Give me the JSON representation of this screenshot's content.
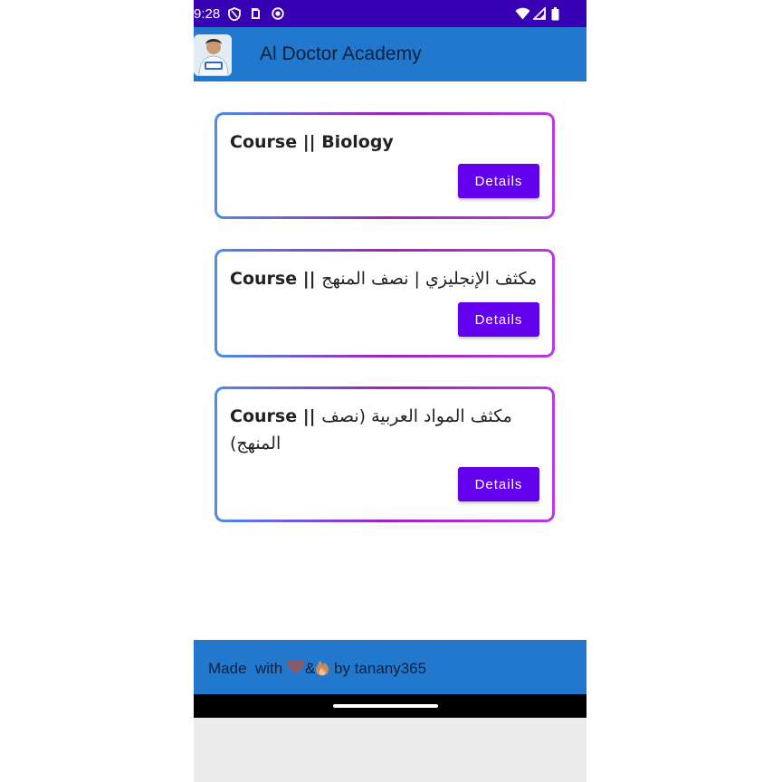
{
  "status_bar": {
    "time": "9:28",
    "icons": [
      "shield-icon",
      "sim-card-icon",
      "record-icon",
      "wifi-icon",
      "signal-icon",
      "battery-icon"
    ]
  },
  "app_bar": {
    "title": "Al Doctor Academy",
    "avatar": "avatar-icon"
  },
  "courses": [
    {
      "prefix": "Course || ",
      "name": "Biology",
      "button": "Details"
    },
    {
      "prefix": "Course || ",
      "name": "مكثف الإنجليزي | نصف المنهج",
      "button": "Details"
    },
    {
      "prefix": "Course || ",
      "name": "مكثف المواد العربية (نصف المنهج)",
      "button": "Details"
    }
  ],
  "footer": {
    "made": "Made  with ",
    "and": "&",
    "by": " by tanany365",
    "icons": [
      "heart-icon",
      "fire-icon"
    ]
  },
  "colors": {
    "status_bar": "#3700b3",
    "app_bar": "#2178cc",
    "button": "#6200ee",
    "card_gradient_start": "#4a8ee6",
    "card_gradient_mid": "#a222b8",
    "card_gradient_end": "#b83ae0"
  }
}
